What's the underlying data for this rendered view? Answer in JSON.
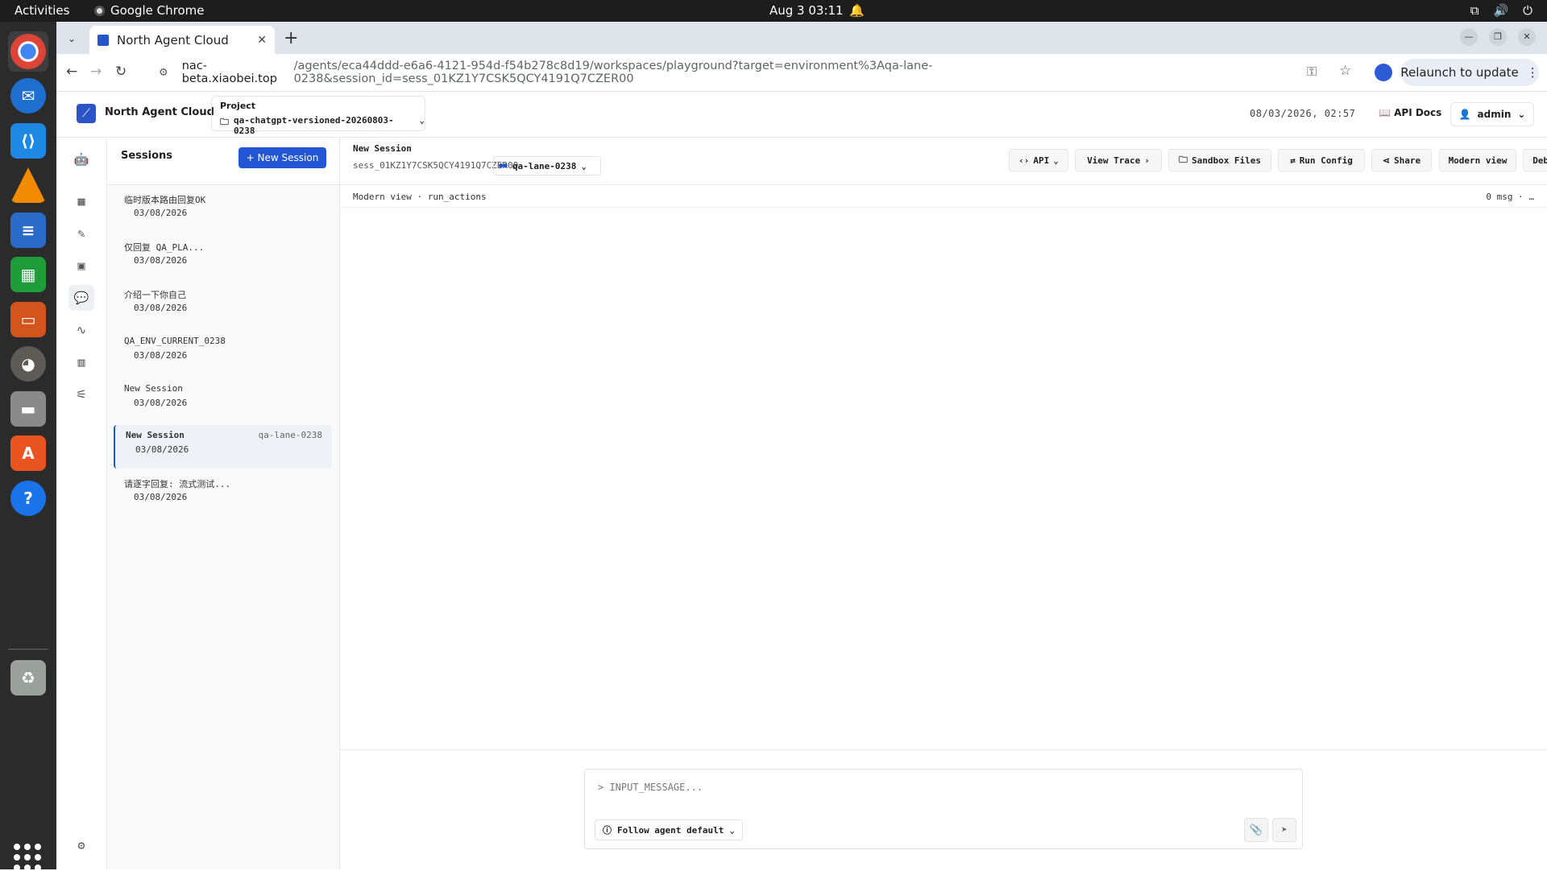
{
  "system": {
    "activities": "Activities",
    "app_name": "Google Chrome",
    "clock": "Aug 3  03:11"
  },
  "browser": {
    "tab_title": "North Agent Cloud",
    "url_host": "nac-beta.xiaobei.top",
    "url_path": "/agents/eca44ddd-e6a6-4121-954d-f54b278c8d19/workspaces/playground?target=environment%3Aqa-lane-0238&session_id=sess_01KZ1Y7CSK5QCY4191Q7CZER00",
    "relaunch_label": "Relaunch to update"
  },
  "app": {
    "brand": "North Agent Cloud",
    "project_label": "Project",
    "project_value": "qa-chatgpt-versioned-20260803-0238",
    "timestamp": "08/03/2026, 02:57",
    "api_docs": "API Docs",
    "user": "admin"
  },
  "sessions": {
    "title": "Sessions",
    "new_label": "+ New Session",
    "items": [
      {
        "name": "临时版本路由回复OK",
        "date": "03/08/2026",
        "tag": ""
      },
      {
        "name": "仅回复 QA_PLA...",
        "date": "03/08/2026",
        "tag": ""
      },
      {
        "name": "介绍一下你自己",
        "date": "03/08/2026",
        "tag": ""
      },
      {
        "name": "QA_ENV_CURRENT_0238",
        "date": "03/08/2026",
        "tag": ""
      },
      {
        "name": "New Session",
        "date": "03/08/2026",
        "tag": ""
      },
      {
        "name": "New Session",
        "date": "03/08/2026",
        "tag": "qa-lane-0238"
      },
      {
        "name": "请逐字回复: 流式测试...",
        "date": "03/08/2026",
        "tag": ""
      }
    ]
  },
  "main": {
    "session_title": "New Session",
    "session_id": "sess_01KZ1Y7CSK5QCY4191Q7CZER00",
    "lane": "qa-lane-0238",
    "buttons": {
      "api": "API",
      "view_trace": "View Trace",
      "sandbox_files": "Sandbox Files",
      "run_config": "Run Config",
      "share": "Share",
      "modern_view": "Modern view",
      "debug_log": "Debug log"
    },
    "subheader_left": "Modern view · run_actions",
    "subheader_right": "0 msg · …",
    "input_placeholder": "> INPUT_MESSAGE...",
    "follow_label": "Follow agent default"
  },
  "colors": {
    "accent": "#2356d4",
    "dock_bg": "#2b2b2b",
    "topbar_bg": "#1d1d1d"
  }
}
